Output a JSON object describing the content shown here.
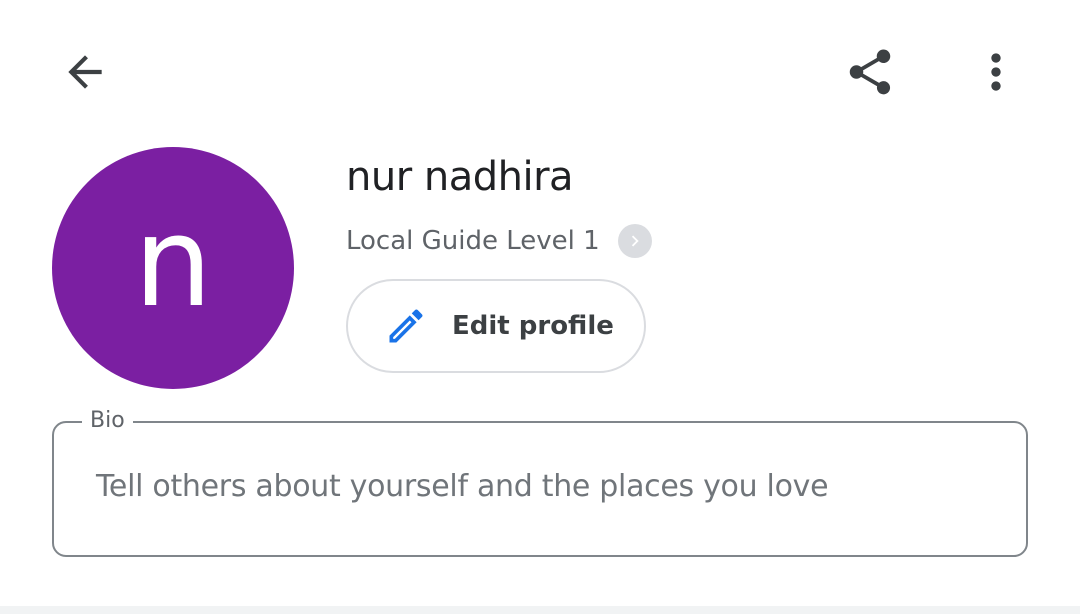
{
  "topbar": {
    "back_icon": "arrow-back-icon",
    "share_icon": "share-icon",
    "more_icon": "more-vert-icon"
  },
  "profile": {
    "avatar_letter": "n",
    "avatar_color": "#7b1fa2",
    "name": "nur nadhira",
    "guide_level": "Local Guide Level 1",
    "edit_button_label": "Edit profile",
    "edit_icon": "pencil-icon",
    "accent_color": "#1a73e8"
  },
  "bio": {
    "label": "Bio",
    "placeholder": "Tell others about yourself and the places you love"
  }
}
